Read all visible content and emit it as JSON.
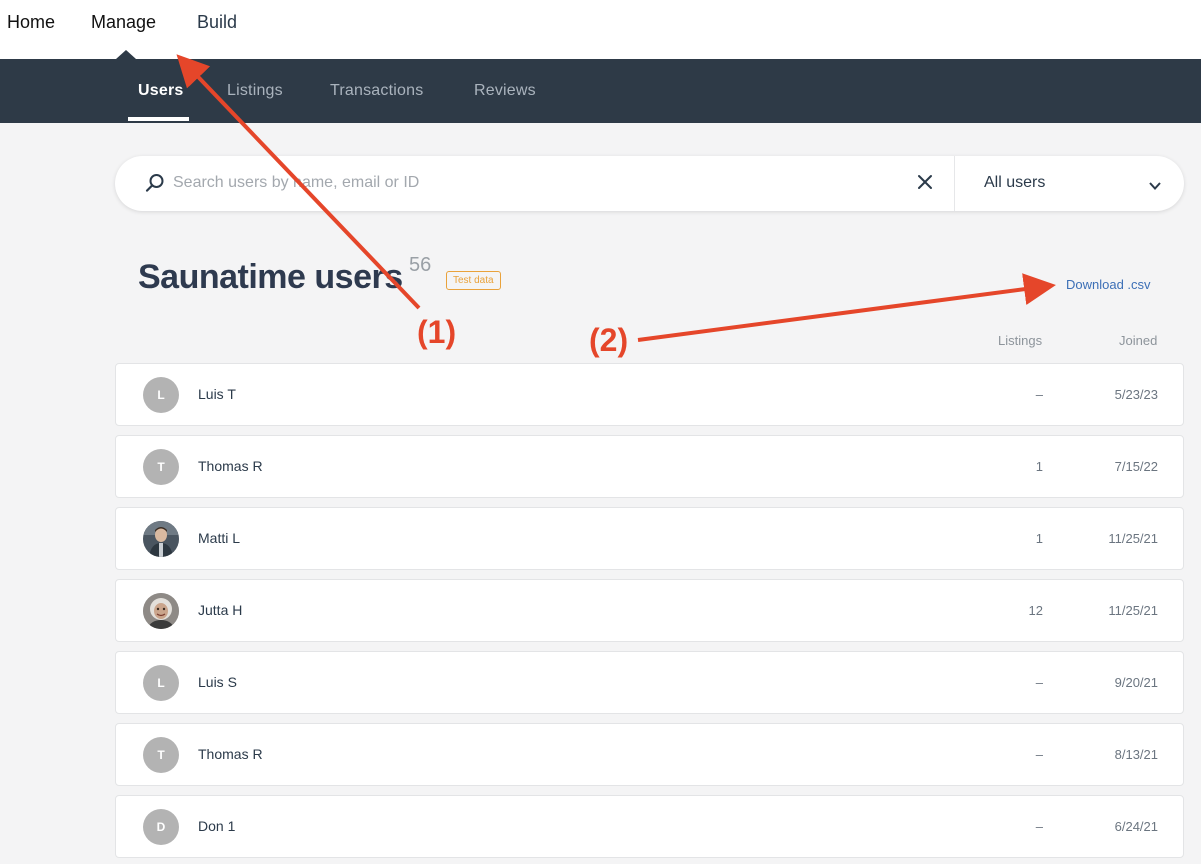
{
  "top_nav": {
    "items": [
      {
        "label": "Home"
      },
      {
        "label": "Manage"
      },
      {
        "label": "Build"
      }
    ]
  },
  "sub_nav": {
    "tabs": [
      {
        "label": "Users",
        "active": true
      },
      {
        "label": "Listings"
      },
      {
        "label": "Transactions"
      },
      {
        "label": "Reviews"
      }
    ]
  },
  "search": {
    "placeholder": "Search users by name, email or ID",
    "filter_value": "All users",
    "search_icon": "search-icon",
    "clear_icon": "close-icon",
    "dropdown_icon": "chevron-down-icon"
  },
  "heading": {
    "title": "Saunatime users",
    "count": "56",
    "badge": "Test data",
    "download_label": "Download .csv"
  },
  "columns": {
    "listings": "Listings",
    "joined": "Joined"
  },
  "users": [
    {
      "initial": "L",
      "name": "Luis T",
      "listings": "–",
      "joined": "5/23/23"
    },
    {
      "initial": "T",
      "name": "Thomas R",
      "listings": "1",
      "joined": "7/15/22"
    },
    {
      "initial": "",
      "name": "Matti L",
      "listings": "1",
      "joined": "11/25/21",
      "photo": true
    },
    {
      "initial": "",
      "name": "Jutta H",
      "listings": "12",
      "joined": "11/25/21",
      "photo": true
    },
    {
      "initial": "L",
      "name": "Luis S",
      "listings": "–",
      "joined": "9/20/21"
    },
    {
      "initial": "T",
      "name": "Thomas R",
      "listings": "–",
      "joined": "8/13/21"
    },
    {
      "initial": "D",
      "name": "Don 1",
      "listings": "–",
      "joined": "6/24/21"
    }
  ],
  "annotations": {
    "label_1": "(1)",
    "label_2": "(2)",
    "arrow_color": "#e5462a"
  },
  "colors": {
    "nav_dark": "#2e3a47",
    "accent_link": "#3c6fb6",
    "badge": "#e9a23b"
  }
}
